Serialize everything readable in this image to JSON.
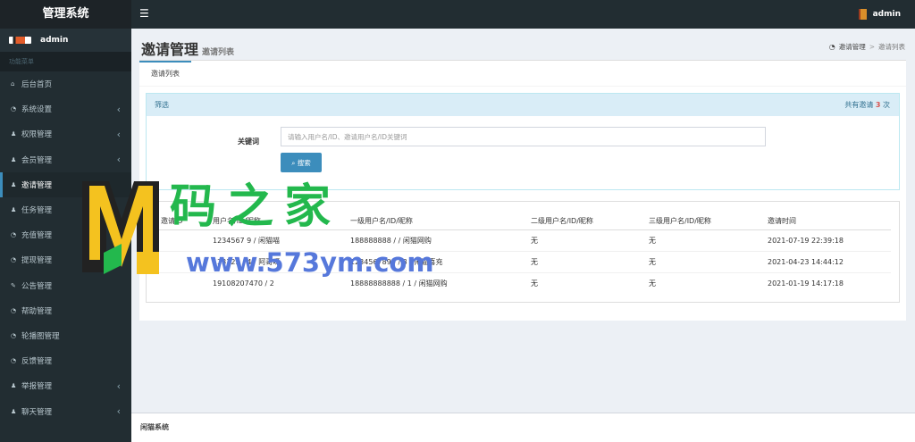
{
  "app": {
    "title": "管理系统",
    "user": "admin",
    "menu_icon": "hamburger-icon"
  },
  "sidebar": {
    "heading": "功能菜单",
    "items": [
      {
        "label": "后台首页",
        "icon": "home-icon",
        "has_arrow": false
      },
      {
        "label": "系统设置",
        "icon": "dashboard-icon",
        "has_arrow": true
      },
      {
        "label": "权限管理",
        "icon": "users-icon",
        "has_arrow": true
      },
      {
        "label": "会员管理",
        "icon": "users-icon",
        "has_arrow": true
      },
      {
        "label": "邀请管理",
        "icon": "users-icon",
        "has_arrow": false,
        "active": true
      },
      {
        "label": "任务管理",
        "icon": "users-icon",
        "has_arrow": false
      },
      {
        "label": "充值管理",
        "icon": "dashboard-icon",
        "has_arrow": false
      },
      {
        "label": "提现管理",
        "icon": "dashboard-icon",
        "has_arrow": false
      },
      {
        "label": "公告管理",
        "icon": "edit-icon",
        "has_arrow": false
      },
      {
        "label": "帮助管理",
        "icon": "dashboard-icon",
        "has_arrow": false
      },
      {
        "label": "轮播图管理",
        "icon": "dashboard-icon",
        "has_arrow": false
      },
      {
        "label": "反馈管理",
        "icon": "dashboard-icon",
        "has_arrow": false
      },
      {
        "label": "举报管理",
        "icon": "users-icon",
        "has_arrow": true
      },
      {
        "label": "聊天管理",
        "icon": "users-icon",
        "has_arrow": true
      }
    ]
  },
  "page": {
    "title": "邀请管理",
    "subtitle": "邀请列表",
    "breadcrumb": {
      "parent": "邀请管理",
      "current": "邀请列表"
    },
    "tab": "邀请列表",
    "filter": {
      "title": "筛选",
      "summary_prefix": "共有邀请",
      "count": "3",
      "summary_suffix": "次",
      "keyword_label": "关键词",
      "search_placeholder": "请输入用户名/ID、邀请用户名/ID关键词",
      "search_button": "搜索"
    },
    "table": {
      "headers": [
        "邀请ID",
        "用户名/ID/昵称",
        "一级用户名/ID/昵称",
        "二级用户名/ID/昵称",
        "三级用户名/ID/昵称",
        "邀请时间"
      ],
      "rows": [
        [
          "",
          "1234567 9 / 闲猫喵",
          "188888888 / / 闲猫网购",
          "无",
          "无",
          "2021-07-19 22:39:18"
        ],
        [
          "",
          "123123 / 4 / 阿哥呀",
          "1234567890 / 3 / 闲猫喜充",
          "无",
          "无",
          "2021-04-23 14:44:12"
        ],
        [
          "",
          "19108207470 / 2",
          "18888888888 / 1 / 闲猫网购",
          "无",
          "无",
          "2021-01-19 14:17:18"
        ]
      ]
    }
  },
  "footer": {
    "text": "闲猫系统"
  },
  "watermark": {
    "chinese": "码之家",
    "url": "www.573ym.com",
    "colors": {
      "green": "#23b84d",
      "blue": "#5678db",
      "yellow": "#f4c21f"
    }
  },
  "colors": {
    "sidebar": "#222d32",
    "primary": "#3c8dbc",
    "info_header": "#d9edf7",
    "count": "#d9534f"
  }
}
